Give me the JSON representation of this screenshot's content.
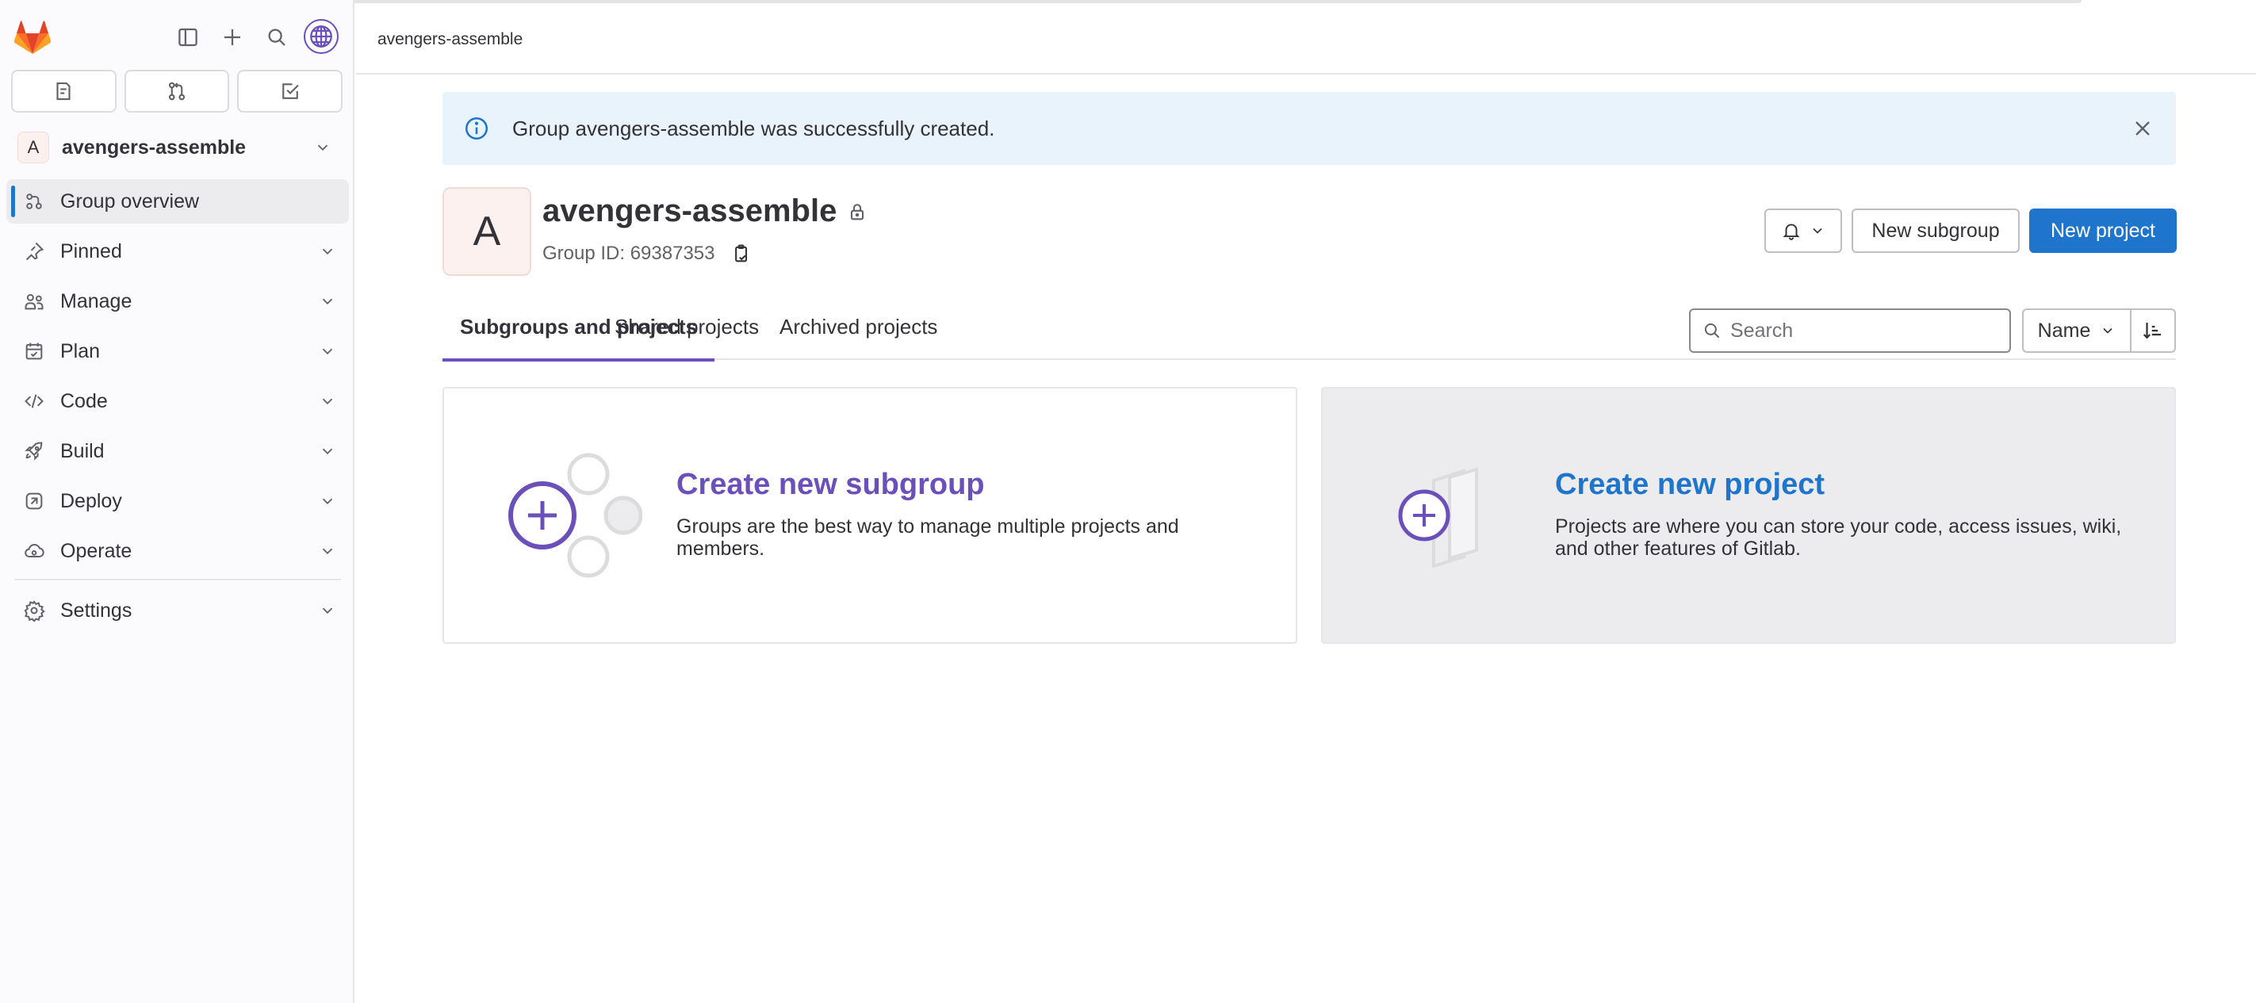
{
  "breadcrumb": {
    "current": "avengers-assemble"
  },
  "sidebar": {
    "context": {
      "avatar_letter": "A",
      "name": "avengers-assemble"
    },
    "quick_tabs": [
      {
        "name": "issues",
        "icon": "issues-icon"
      },
      {
        "name": "merge-requests",
        "icon": "merge-request-icon"
      },
      {
        "name": "todos",
        "icon": "todo-icon"
      }
    ],
    "items": [
      {
        "label": "Group overview",
        "icon": "group-overview-icon",
        "active": true
      },
      {
        "label": "Pinned",
        "icon": "pin-icon"
      },
      {
        "label": "Manage",
        "icon": "users-icon"
      },
      {
        "label": "Plan",
        "icon": "calendar-icon"
      },
      {
        "label": "Code",
        "icon": "code-icon"
      },
      {
        "label": "Build",
        "icon": "rocket-icon"
      },
      {
        "label": "Deploy",
        "icon": "deploy-icon"
      },
      {
        "label": "Operate",
        "icon": "cloud-icon"
      },
      {
        "label": "Settings",
        "icon": "gear-icon"
      }
    ]
  },
  "alert": {
    "message": "Group avengers-assemble was successfully created."
  },
  "group": {
    "avatar_letter": "A",
    "name": "avengers-assemble",
    "id_label": "Group ID: 69387353"
  },
  "actions": {
    "new_subgroup": "New subgroup",
    "new_project": "New project"
  },
  "tabs": [
    {
      "label": "Subgroups and projects",
      "active": true
    },
    {
      "label": "Shared projects"
    },
    {
      "label": "Archived projects"
    }
  ],
  "filter": {
    "search_placeholder": "Search",
    "sort_label": "Name"
  },
  "cards": {
    "subgroup": {
      "title": "Create new subgroup",
      "description": "Groups are the best way to manage multiple projects and members."
    },
    "project": {
      "title": "Create new project",
      "description": "Projects are where you can store your code, access issues, wiki, and other features of Gitlab."
    }
  },
  "colors": {
    "primary": "#1f75cb",
    "purple": "#6b4fbb",
    "alert_bg": "#e9f3fc",
    "gitlab_orange": "#e24329"
  }
}
